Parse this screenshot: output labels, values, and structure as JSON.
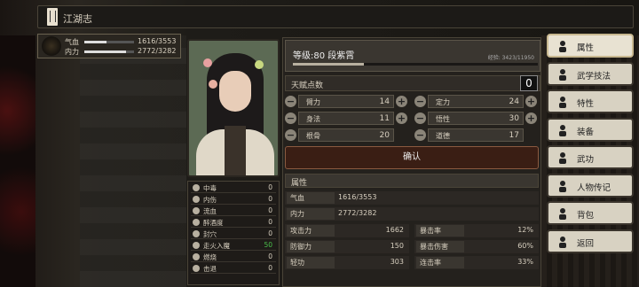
{
  "window": {
    "title": "江湖志"
  },
  "player": {
    "qi_label": "气血",
    "qi_value": "1616/3553",
    "qi_fill": 0.45,
    "neili_label": "内力",
    "neili_value": "2772/3282",
    "neili_fill": 0.84
  },
  "level": {
    "text": "等级:80 段紫霄",
    "exp": "经验: 3423/11950",
    "exp_fill": 0.29
  },
  "points": {
    "label": "天赋点数",
    "value": "0"
  },
  "stats": [
    {
      "name": "臂力",
      "value": "14"
    },
    {
      "name": "定力",
      "value": "24"
    },
    {
      "name": "身法",
      "value": "11"
    },
    {
      "name": "悟性",
      "value": "30"
    },
    {
      "name": "根骨",
      "value": "20"
    },
    {
      "name": "道德",
      "value": "17"
    }
  ],
  "confirm_label": "确认",
  "attributes": {
    "section_title": "属性",
    "qi": {
      "label": "气血",
      "value": "1616/3553"
    },
    "neili": {
      "label": "内力",
      "value": "2772/3282"
    },
    "grid": [
      {
        "label": "攻击力",
        "value": "1662"
      },
      {
        "label": "暴击率",
        "value": "12%"
      },
      {
        "label": "防御力",
        "value": "150"
      },
      {
        "label": "暴击伤害",
        "value": "60%"
      },
      {
        "label": "轻功",
        "value": "303"
      },
      {
        "label": "连击率",
        "value": "33%"
      }
    ]
  },
  "status_effects": [
    {
      "name": "中毒",
      "value": "0",
      "icon": "poison-icon"
    },
    {
      "name": "内伤",
      "value": "0",
      "icon": "internal-injury-icon"
    },
    {
      "name": "流血",
      "value": "0",
      "icon": "bleed-icon"
    },
    {
      "name": "醉酒度",
      "value": "0",
      "icon": "drunk-icon"
    },
    {
      "name": "封穴",
      "value": "0",
      "icon": "seal-icon"
    },
    {
      "name": "走火入魔",
      "value": "50",
      "icon": "qi-deviation-icon",
      "color": "#4ac04a"
    },
    {
      "name": "燃烧",
      "value": "0",
      "icon": "burn-icon"
    },
    {
      "name": "击退",
      "value": "0",
      "icon": "knockback-icon"
    }
  ],
  "menu": [
    {
      "label": "属性",
      "icon": "person-icon"
    },
    {
      "label": "武学技法",
      "icon": "martial-skill-icon"
    },
    {
      "label": "特性",
      "icon": "trait-icon"
    },
    {
      "label": "装备",
      "icon": "sword-icon"
    },
    {
      "label": "武功",
      "icon": "scroll-icon"
    },
    {
      "label": "人物传记",
      "icon": "book-icon"
    },
    {
      "label": "背包",
      "icon": "bag-icon"
    },
    {
      "label": "返回",
      "icon": "exit-door-icon"
    }
  ]
}
